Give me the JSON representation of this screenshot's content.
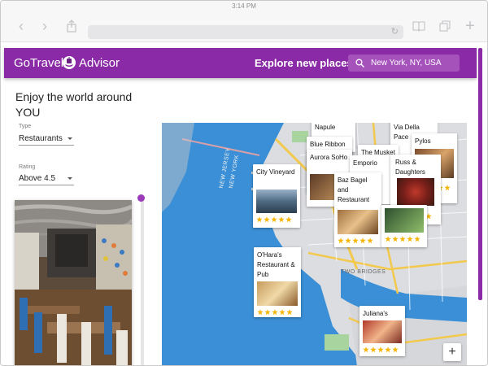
{
  "status_bar": {
    "time": "3:14 PM"
  },
  "browser": {
    "toolbar_icons": [
      "back-icon",
      "forward-icon",
      "share-icon",
      "bookmarks-icon",
      "tabs-icon",
      "new-tab-icon"
    ],
    "reload_icon": "reload-icon"
  },
  "app": {
    "logo_part1": "GoTravel",
    "logo_part2": "Advisor",
    "explore_label": "Explore new places",
    "search_value": "New York, NY, USA",
    "brand_color": "#8b2aa6"
  },
  "left_panel": {
    "heading": "Enjoy the world around YOU",
    "type_label": "Type",
    "type_value": "Restaurants",
    "rating_label": "Rating",
    "rating_value": "Above 4.5"
  },
  "map": {
    "labels": {
      "new_jersey": "NEW JERSEY",
      "new_york": "NEW YORK",
      "two_bridges": "TWO BRIDGES"
    },
    "zoom_in": "+",
    "places": [
      {
        "name": "City Vineyard",
        "rating": 5
      },
      {
        "name": "Blue Ribbon",
        "rating": 5
      },
      {
        "name": "Aurora SoHo",
        "rating": 5
      },
      {
        "name": "Emporio",
        "rating": 5
      },
      {
        "name": "Baz Bagel and Restaurant",
        "rating": 5
      },
      {
        "name": "The Musket Room",
        "rating": 5
      },
      {
        "name": "Via Della Pace",
        "rating": 5
      },
      {
        "name": "Pylos",
        "rating": 5
      },
      {
        "name": "Russ & Daughters",
        "rating": 5
      },
      {
        "name": "O'Hara's Restaurant & Pub",
        "rating": 5
      },
      {
        "name": "Juliana's",
        "rating": 5
      },
      {
        "name": "Napule",
        "rating": 5
      }
    ]
  }
}
